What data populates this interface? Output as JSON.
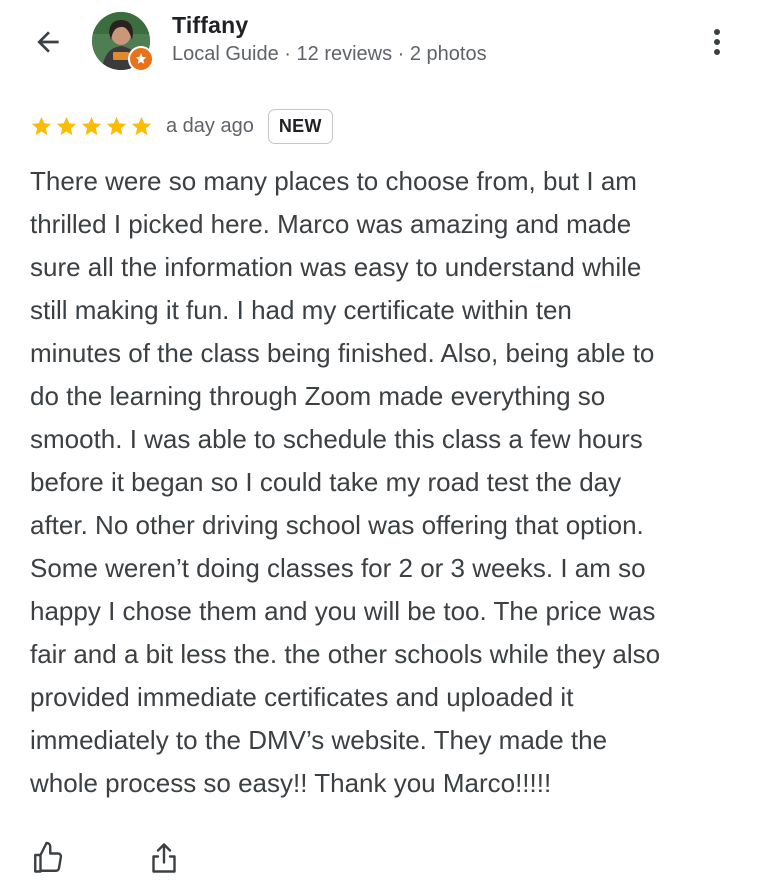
{
  "reviewer": {
    "name": "Tiffany",
    "meta": "Local Guide · 12 reviews · 2 photos"
  },
  "rating": {
    "stars": 5,
    "time": "a day ago",
    "badge": "NEW"
  },
  "review": {
    "text": "There were so many places to choose from, but I am\nthrilled I picked here. Marco was amazing and made\nsure all the information was easy to understand while\nstill making it fun. I had my certificate within ten\nminutes of the class being finished. Also, being able to\ndo the learning through Zoom made everything so\nsmooth. I was able to schedule this class a few hours\nbefore it began so I could take my road test the day\nafter. No other driving school was offering that option.\nSome weren’t doing classes for 2 or 3 weeks. I am so\nhappy I chose them and you will be too. The price was\nfair and a bit less the. the other schools while they also\nprovided immediate certificates and uploaded it\nimmediately to the DMV’s website. They made the\nwhole process so easy!! Thank you Marco!!!!!"
  },
  "icons": {
    "back": "arrow-left-icon",
    "more": "more-vert-icon",
    "star": "star-icon",
    "guide_badge": "local-guide-icon",
    "like": "thumbs-up-icon",
    "share": "share-icon"
  },
  "colors": {
    "star": "#fbbc04",
    "guide_badge": "#e8711a",
    "text": "#3c4043",
    "secondary_text": "#5f6368"
  }
}
